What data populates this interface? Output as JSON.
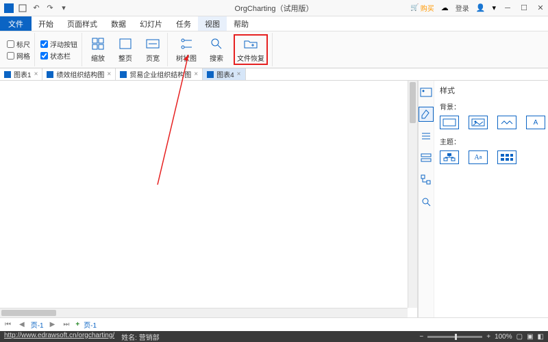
{
  "app": {
    "title": "OrgCharting（试用版）"
  },
  "qat": {
    "buy": "购买",
    "login": "登录"
  },
  "menu": {
    "file": "文件",
    "items": [
      "开始",
      "页面样式",
      "数据",
      "幻灯片",
      "任务",
      "视图",
      "帮助"
    ],
    "active": 5
  },
  "ribbon": {
    "checks": {
      "ruler": "标尺",
      "floatBtn": "浮动按钮",
      "grid": "网格",
      "statusBar": "状态栏"
    },
    "buttons": {
      "zoom": "缩放",
      "fullPage": "整页",
      "pageWidth": "页宽",
      "treeView": "树状图",
      "search": "搜索",
      "fileRecover": "文件恢复"
    }
  },
  "tabs": [
    {
      "label": "图表1",
      "active": false
    },
    {
      "label": "绩效组织结构图",
      "active": false
    },
    {
      "label": "贸易企业组织结构图",
      "active": false
    },
    {
      "label": "图表4",
      "active": true
    }
  ],
  "rightPanel": {
    "title": "样式",
    "sections": {
      "background": "背景：",
      "theme": "主题："
    }
  },
  "pageBar": {
    "pageLabel": "页-1",
    "pageLabel2": "页-1"
  },
  "status": {
    "url": "http://www.edrawsoft.cn/orgcharting/",
    "nameLbl": "姓名: 营销部",
    "zoomOut": "−",
    "zoomIn": "+",
    "zoomPct": "100%"
  }
}
